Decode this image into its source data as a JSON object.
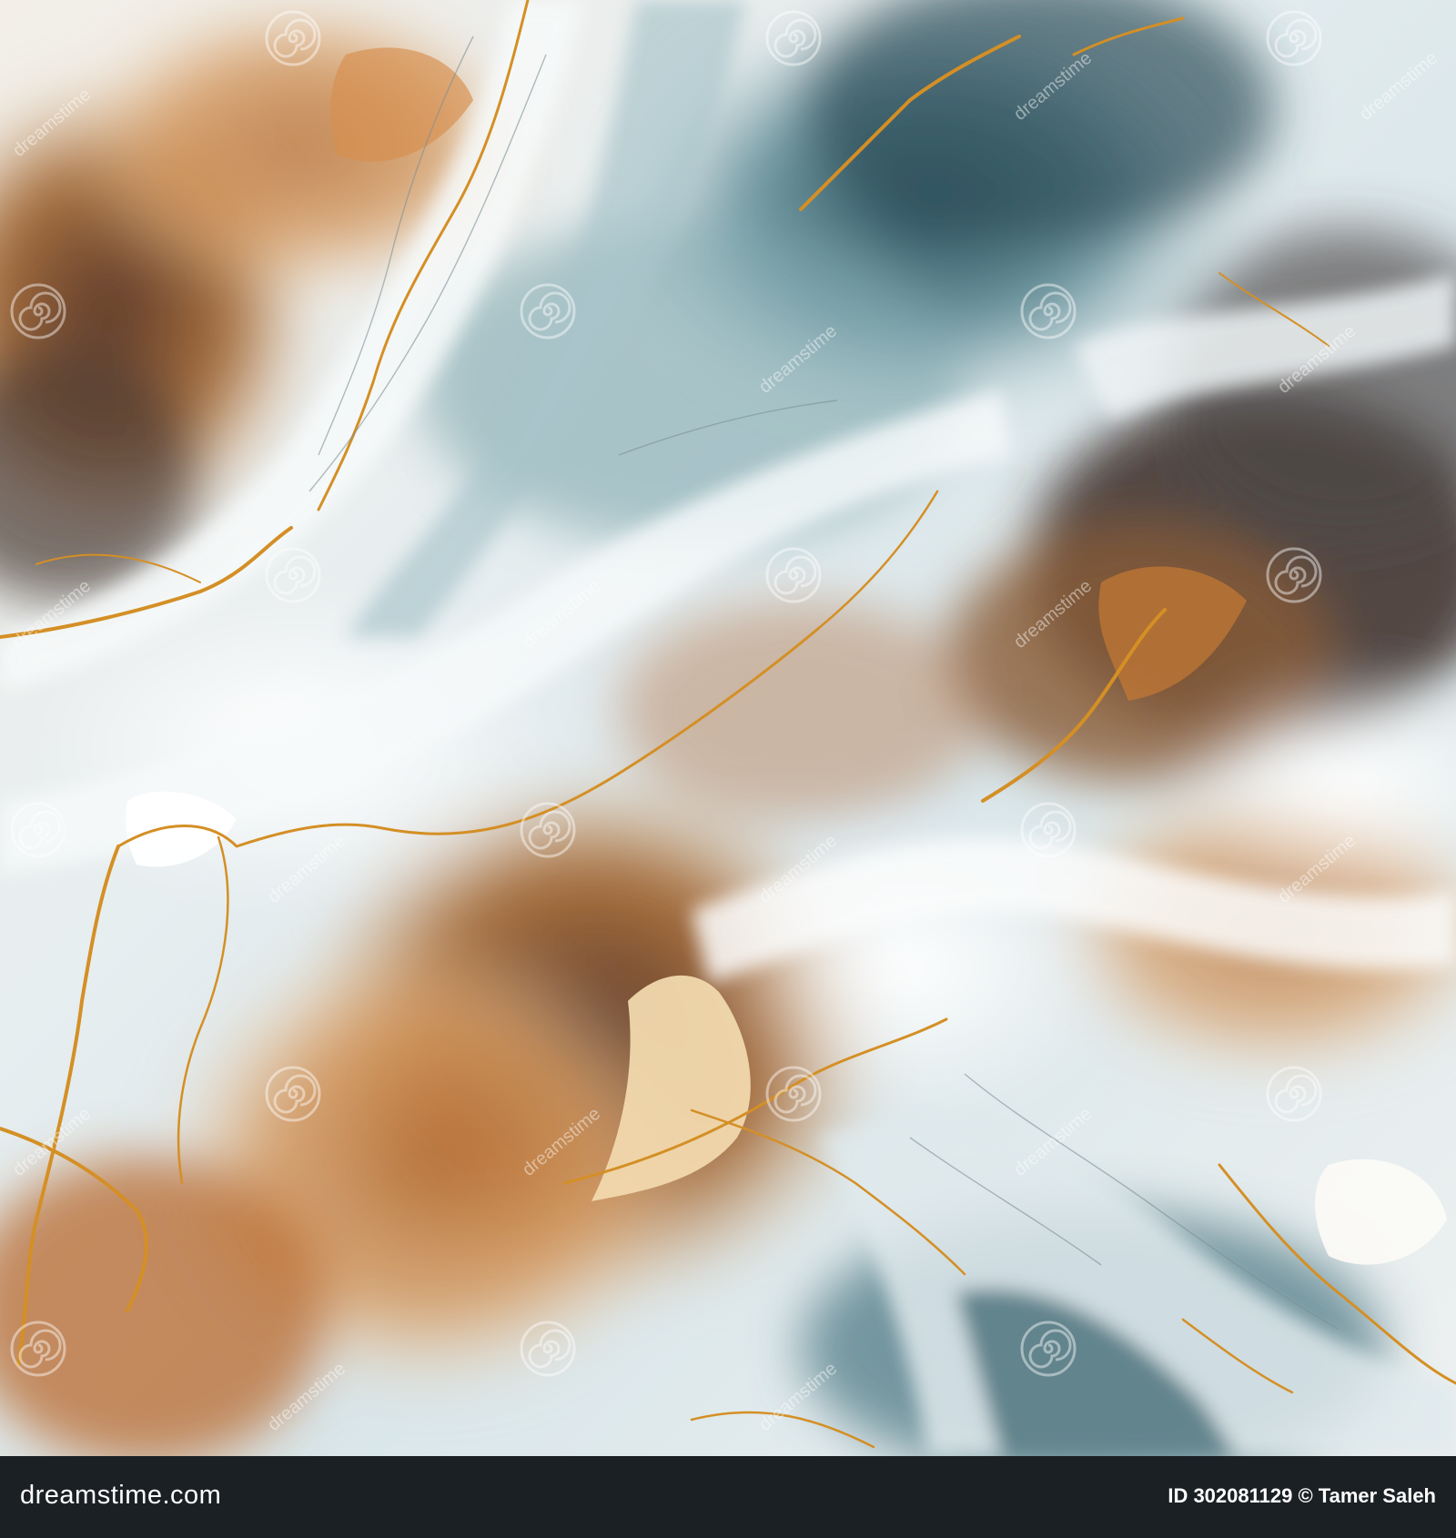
{
  "image": {
    "subject": "abstract marble texture",
    "palette": {
      "white": "#f2f5f4",
      "teal": "#4f7a84",
      "deep_teal": "#244750",
      "copper": "#c8813c",
      "gold_vein": "#d9962b",
      "brown": "#6b4631",
      "cream": "#f0dcb8"
    }
  },
  "watermark": {
    "icon": "dreamstime-swirl-icon",
    "text": "dreamstime"
  },
  "footer": {
    "brand": "dreamstime.com",
    "credit": "ID 302081129 © Tamer Saleh"
  }
}
